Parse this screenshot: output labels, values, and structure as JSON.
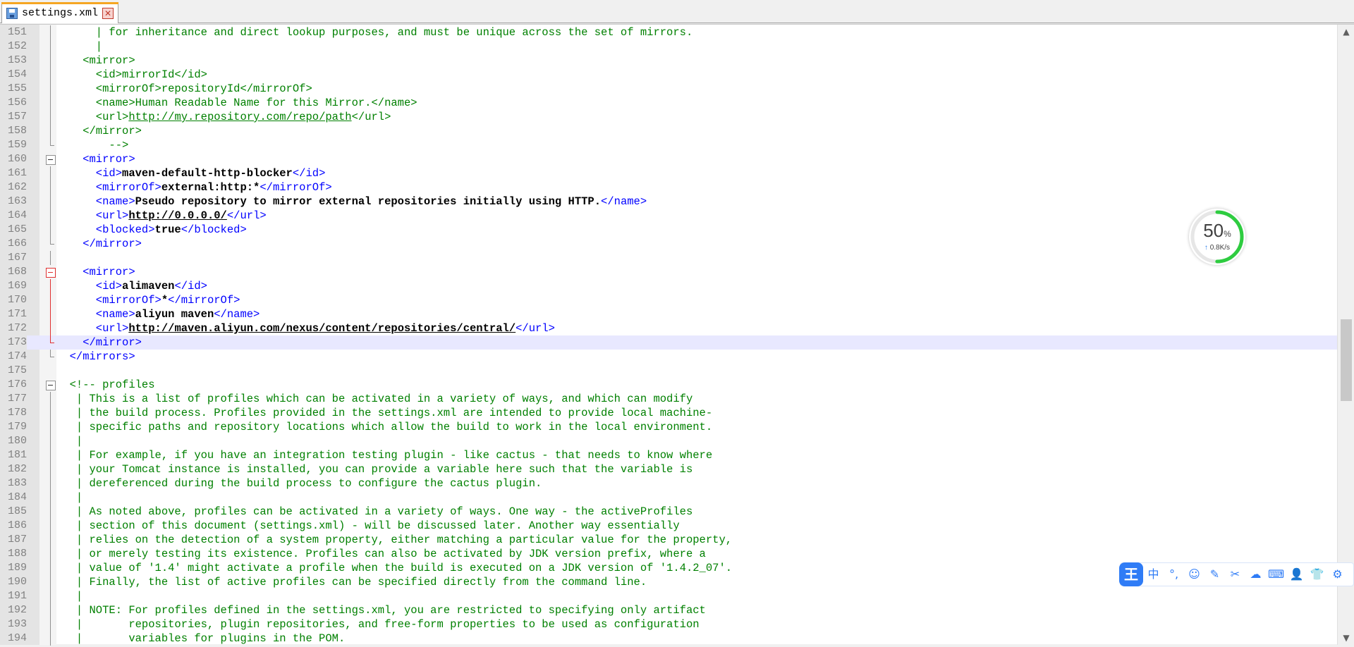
{
  "tab": {
    "filename": "settings.xml",
    "close_glyph": "✕"
  },
  "widget": {
    "percent": "50",
    "percent_sign": "%",
    "speed": "0.8K/s",
    "arrow": "↑",
    "ring_color": "#2ecc40"
  },
  "ime": {
    "logo": "王",
    "items": [
      {
        "name": "chinese-mode",
        "glyph": "中"
      },
      {
        "name": "punctuation",
        "glyph": "°,"
      },
      {
        "name": "emoji",
        "glyph": "☺"
      },
      {
        "name": "handwriting",
        "glyph": "✎"
      },
      {
        "name": "screenshot",
        "glyph": "✂"
      },
      {
        "name": "cloud",
        "glyph": "☁"
      },
      {
        "name": "keyboard",
        "glyph": "⌨"
      },
      {
        "name": "user",
        "glyph": "👤"
      },
      {
        "name": "skin",
        "glyph": "👕"
      },
      {
        "name": "settings",
        "glyph": "⚙"
      }
    ]
  },
  "lines": [
    {
      "n": "151",
      "fold": "vline",
      "segs": [
        [
          "cm",
          "      | for inheritance and direct lookup purposes, and must be unique across the set of mirrors."
        ]
      ]
    },
    {
      "n": "152",
      "fold": "vline",
      "segs": [
        [
          "cm",
          "      |"
        ]
      ]
    },
    {
      "n": "153",
      "fold": "vline",
      "segs": [
        [
          "cm",
          "    <mirror>"
        ]
      ]
    },
    {
      "n": "154",
      "fold": "vline",
      "segs": [
        [
          "cm",
          "      <id>mirrorId</id>"
        ]
      ]
    },
    {
      "n": "155",
      "fold": "vline",
      "segs": [
        [
          "cm",
          "      <mirrorOf>repositoryId</mirrorOf>"
        ]
      ]
    },
    {
      "n": "156",
      "fold": "vline",
      "segs": [
        [
          "cm",
          "      <name>Human Readable Name for this Mirror.</name>"
        ]
      ]
    },
    {
      "n": "157",
      "fold": "vline",
      "segs": [
        [
          "cm",
          "      <url>"
        ],
        [
          "cm ul",
          "http://my.repository.com/repo/path"
        ],
        [
          "cm",
          "</url>"
        ]
      ]
    },
    {
      "n": "158",
      "fold": "vline",
      "segs": [
        [
          "cm",
          "    </mirror>"
        ]
      ]
    },
    {
      "n": "159",
      "fold": "endline",
      "segs": [
        [
          "cm",
          "        -->"
        ]
      ]
    },
    {
      "n": "160",
      "fold": "box",
      "segs": [
        [
          "tg",
          "    <mirror>"
        ]
      ]
    },
    {
      "n": "161",
      "fold": "vline",
      "segs": [
        [
          "tg",
          "      <id>"
        ],
        [
          "tx",
          "maven-default-http-blocker"
        ],
        [
          "tg",
          "</id>"
        ]
      ]
    },
    {
      "n": "162",
      "fold": "vline",
      "segs": [
        [
          "tg",
          "      <mirrorOf>"
        ],
        [
          "tx",
          "external:http:*"
        ],
        [
          "tg",
          "</mirrorOf>"
        ]
      ]
    },
    {
      "n": "163",
      "fold": "vline",
      "segs": [
        [
          "tg",
          "      <name>"
        ],
        [
          "tx",
          "Pseudo repository to mirror external repositories initially using HTTP."
        ],
        [
          "tg",
          "</name>"
        ]
      ]
    },
    {
      "n": "164",
      "fold": "vline",
      "segs": [
        [
          "tg",
          "      <url>"
        ],
        [
          "tx ul",
          "http://0.0.0.0/"
        ],
        [
          "tg",
          "</url>"
        ]
      ]
    },
    {
      "n": "165",
      "fold": "vline",
      "segs": [
        [
          "tg",
          "      <blocked>"
        ],
        [
          "tx",
          "true"
        ],
        [
          "tg",
          "</blocked>"
        ]
      ]
    },
    {
      "n": "166",
      "fold": "endline",
      "segs": [
        [
          "tg",
          "    </mirror>"
        ]
      ]
    },
    {
      "n": "167",
      "fold": "vline",
      "segs": []
    },
    {
      "n": "168",
      "fold": "box red",
      "segs": [
        [
          "tg",
          "    <mirror>"
        ]
      ]
    },
    {
      "n": "169",
      "fold": "vline red",
      "segs": [
        [
          "tg",
          "      <id>"
        ],
        [
          "tx",
          "alimaven"
        ],
        [
          "tg",
          "</id>"
        ]
      ]
    },
    {
      "n": "170",
      "fold": "vline red",
      "segs": [
        [
          "tg",
          "      <mirrorOf>"
        ],
        [
          "tx",
          "*"
        ],
        [
          "tg",
          "</mirrorOf>"
        ]
      ]
    },
    {
      "n": "171",
      "fold": "vline red",
      "segs": [
        [
          "tg",
          "      <name>"
        ],
        [
          "tx",
          "aliyun maven"
        ],
        [
          "tg",
          "</name>"
        ]
      ]
    },
    {
      "n": "172",
      "fold": "vline red",
      "segs": [
        [
          "tg",
          "      <url>"
        ],
        [
          "tx ul",
          "http://maven.aliyun.com/nexus/content/repositories/central/"
        ],
        [
          "tg",
          "</url>"
        ]
      ]
    },
    {
      "n": "173",
      "fold": "endline red",
      "current": true,
      "segs": [
        [
          "tg",
          "    </mirror>"
        ]
      ]
    },
    {
      "n": "174",
      "fold": "endline",
      "segs": [
        [
          "tg",
          "  </mirrors>"
        ]
      ]
    },
    {
      "n": "175",
      "fold": "",
      "segs": []
    },
    {
      "n": "176",
      "fold": "box",
      "segs": [
        [
          "cm",
          "  <!-- profiles"
        ]
      ]
    },
    {
      "n": "177",
      "fold": "vline",
      "segs": [
        [
          "cm",
          "   | This is a list of profiles which can be activated in a variety of ways, and which can modify"
        ]
      ]
    },
    {
      "n": "178",
      "fold": "vline",
      "segs": [
        [
          "cm",
          "   | the build process. Profiles provided in the settings.xml are intended to provide local machine-"
        ]
      ]
    },
    {
      "n": "179",
      "fold": "vline",
      "segs": [
        [
          "cm",
          "   | specific paths and repository locations which allow the build to work in the local environment."
        ]
      ]
    },
    {
      "n": "180",
      "fold": "vline",
      "segs": [
        [
          "cm",
          "   |"
        ]
      ]
    },
    {
      "n": "181",
      "fold": "vline",
      "segs": [
        [
          "cm",
          "   | For example, if you have an integration testing plugin - like cactus - that needs to know where"
        ]
      ]
    },
    {
      "n": "182",
      "fold": "vline",
      "segs": [
        [
          "cm",
          "   | your Tomcat instance is installed, you can provide a variable here such that the variable is"
        ]
      ]
    },
    {
      "n": "183",
      "fold": "vline",
      "segs": [
        [
          "cm",
          "   | dereferenced during the build process to configure the cactus plugin."
        ]
      ]
    },
    {
      "n": "184",
      "fold": "vline",
      "segs": [
        [
          "cm",
          "   |"
        ]
      ]
    },
    {
      "n": "185",
      "fold": "vline",
      "segs": [
        [
          "cm",
          "   | As noted above, profiles can be activated in a variety of ways. One way - the activeProfiles"
        ]
      ]
    },
    {
      "n": "186",
      "fold": "vline",
      "segs": [
        [
          "cm",
          "   | section of this document (settings.xml) - will be discussed later. Another way essentially"
        ]
      ]
    },
    {
      "n": "187",
      "fold": "vline",
      "segs": [
        [
          "cm",
          "   | relies on the detection of a system property, either matching a particular value for the property,"
        ]
      ]
    },
    {
      "n": "188",
      "fold": "vline",
      "segs": [
        [
          "cm",
          "   | or merely testing its existence. Profiles can also be activated by JDK version prefix, where a"
        ]
      ]
    },
    {
      "n": "189",
      "fold": "vline",
      "segs": [
        [
          "cm",
          "   | value of '1.4' might activate a profile when the build is executed on a JDK version of '1.4.2_07'."
        ]
      ]
    },
    {
      "n": "190",
      "fold": "vline",
      "segs": [
        [
          "cm",
          "   | Finally, the list of active profiles can be specified directly from the command line."
        ]
      ]
    },
    {
      "n": "191",
      "fold": "vline",
      "segs": [
        [
          "cm",
          "   |"
        ]
      ]
    },
    {
      "n": "192",
      "fold": "vline",
      "segs": [
        [
          "cm",
          "   | NOTE: For profiles defined in the settings.xml, you are restricted to specifying only artifact"
        ]
      ]
    },
    {
      "n": "193",
      "fold": "vline",
      "segs": [
        [
          "cm",
          "   |       repositories, plugin repositories, and free-form properties to be used as configuration"
        ]
      ]
    },
    {
      "n": "194",
      "fold": "vline",
      "segs": [
        [
          "cm",
          "   |       variables for plugins in the POM."
        ]
      ]
    }
  ]
}
